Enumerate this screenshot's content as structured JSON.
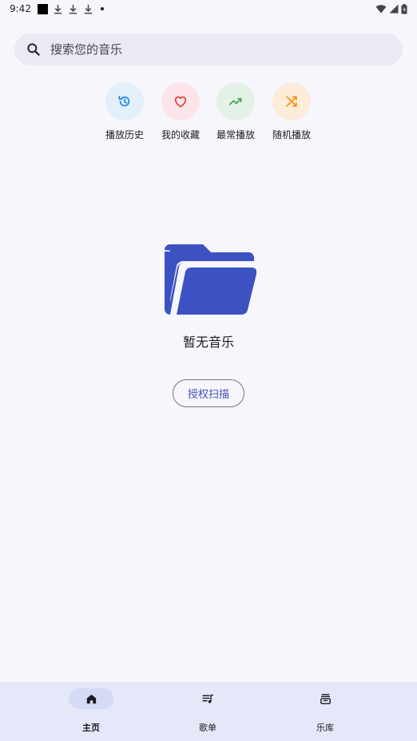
{
  "status_bar": {
    "time": "9:42",
    "left_icons": [
      "notification-square-icon",
      "download-icon",
      "download-icon",
      "download-icon",
      "dot-icon"
    ],
    "right_icons": [
      "wifi-icon",
      "signal-icon",
      "battery-icon"
    ]
  },
  "search": {
    "placeholder": "搜索您的音乐",
    "icon": "search-icon"
  },
  "quick_actions": [
    {
      "label": "播放历史",
      "icon": "history-icon",
      "bg": "#e3effb",
      "fg": "#1e88e5"
    },
    {
      "label": "我的收藏",
      "icon": "heart-icon",
      "bg": "#fbe5ea",
      "fg": "#e53935"
    },
    {
      "label": "最常播放",
      "icon": "trending-up-icon",
      "bg": "#e4f1e6",
      "fg": "#43a047"
    },
    {
      "label": "随机播放",
      "icon": "shuffle-icon",
      "bg": "#fdecd9",
      "fg": "#fb8c00"
    }
  ],
  "empty_state": {
    "icon": "folder-open-icon",
    "icon_color": "#3c52c3",
    "text": "暂无音乐",
    "button_label": "授权扫描"
  },
  "bottom_nav": {
    "items": [
      {
        "label": "主页",
        "icon": "home-icon",
        "active": true
      },
      {
        "label": "歌单",
        "icon": "playlist-icon",
        "active": false
      },
      {
        "label": "乐库",
        "icon": "library-icon",
        "active": false
      }
    ]
  },
  "colors": {
    "background": "#f8f6fd",
    "accent": "#3f51b5",
    "nav_background": "#e5e8f8"
  }
}
